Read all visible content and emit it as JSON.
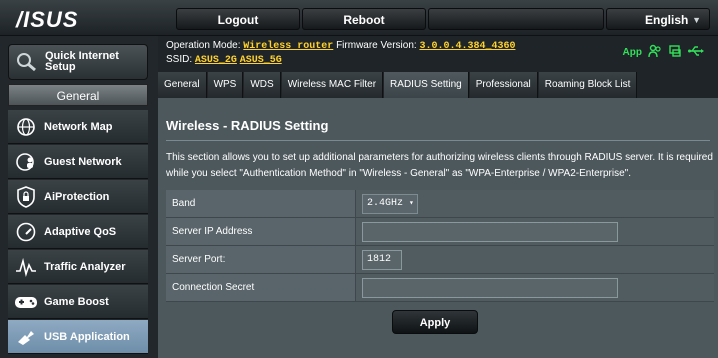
{
  "brand": "/ISUS",
  "topbar": {
    "logout_label": "Logout",
    "reboot_label": "Reboot",
    "language": "English"
  },
  "sidebar": {
    "quick_setup_label": "Quick Internet Setup",
    "section_label": "General",
    "items": [
      {
        "label": "Network Map",
        "icon": "globe-icon"
      },
      {
        "label": "Guest Network",
        "icon": "people-globe-icon"
      },
      {
        "label": "AiProtection",
        "icon": "lock-shield-icon"
      },
      {
        "label": "Adaptive QoS",
        "icon": "speedometer-icon"
      },
      {
        "label": "Traffic Analyzer",
        "icon": "waveform-icon"
      },
      {
        "label": "Game Boost",
        "icon": "gamepad-icon"
      },
      {
        "label": "USB Application",
        "icon": "puzzle-icon"
      }
    ]
  },
  "header": {
    "operation_mode_label": "Operation Mode:",
    "operation_mode_value": "Wireless router",
    "firmware_label": "Firmware Version:",
    "firmware_value": "3.0.0.4.384_4360",
    "ssid_label": "SSID:",
    "ssid_values": [
      "ASUS_2G",
      "ASUS_5G"
    ],
    "app_label": "App"
  },
  "tabs": [
    {
      "label": "General"
    },
    {
      "label": "WPS"
    },
    {
      "label": "WDS"
    },
    {
      "label": "Wireless MAC Filter"
    },
    {
      "label": "RADIUS Setting"
    },
    {
      "label": "Professional"
    },
    {
      "label": "Roaming Block List"
    }
  ],
  "page": {
    "title": "Wireless - RADIUS Setting",
    "description": "This section allows you to set up additional parameters for authorizing wireless clients through RADIUS server. It is required while you select \"Authentication Method\" in \"Wireless - General\" as \"WPA-Enterprise / WPA2-Enterprise\".",
    "fields": {
      "band_label": "Band",
      "band_value": "2.4GHz",
      "server_ip_label": "Server IP Address",
      "server_ip_value": "",
      "server_port_label": "Server Port:",
      "server_port_value": "1812",
      "secret_label": "Connection Secret",
      "secret_value": ""
    },
    "apply_label": "Apply"
  },
  "colors": {
    "accent_yellow": "#ffd22e",
    "status_green": "#33e05a",
    "active_nav": "#7c9ab6"
  }
}
